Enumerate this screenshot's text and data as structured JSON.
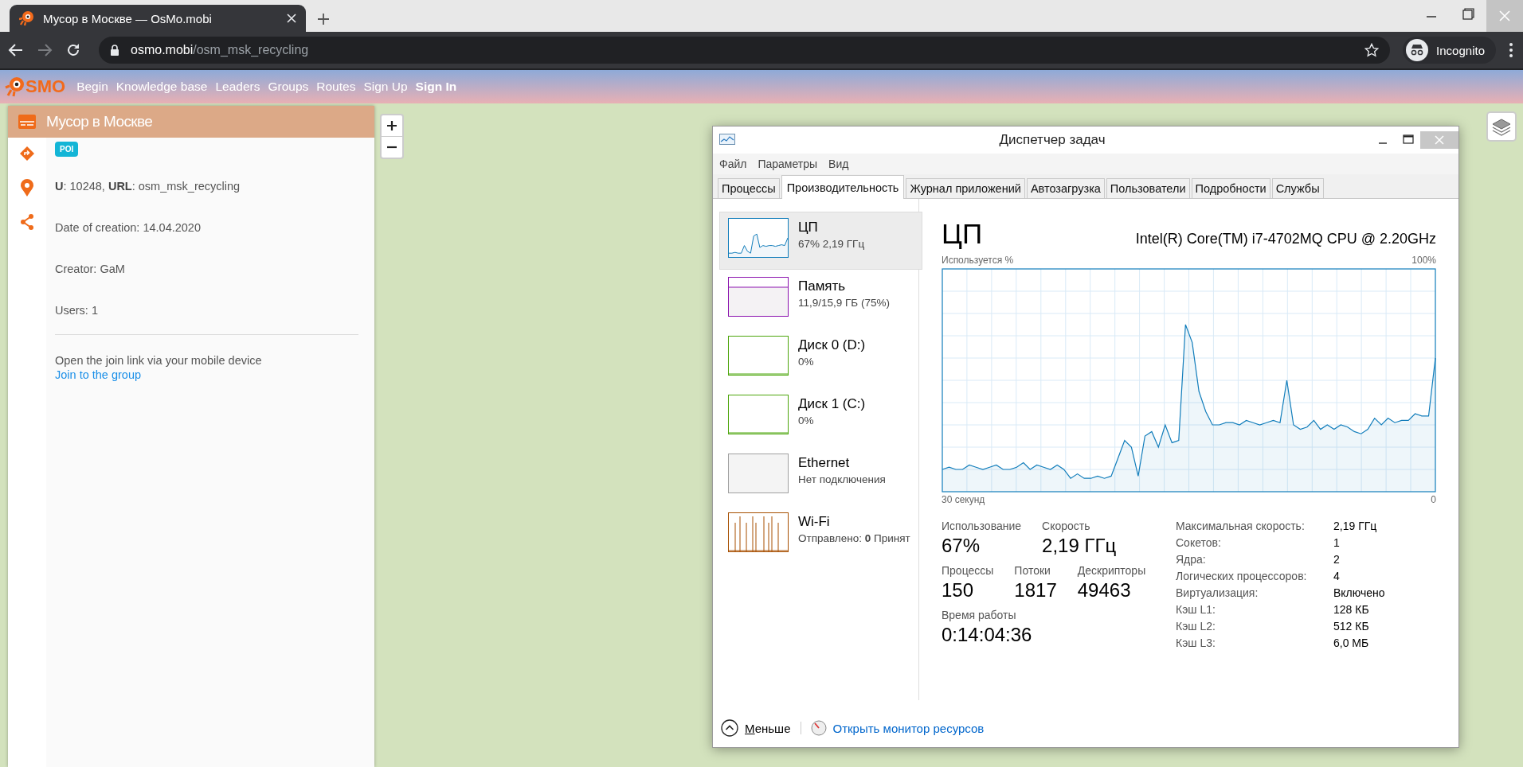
{
  "browser": {
    "tab_title": "Мусор в Москве — OsMo.mobi",
    "url_host": "osmo.mobi",
    "url_path": "/osm_msk_recycling",
    "profile": "Incognito"
  },
  "site": {
    "logo": "SMO",
    "nav": [
      {
        "label": "Begin",
        "kind": "link"
      },
      {
        "label": "Knowledge base",
        "kind": "link"
      },
      {
        "label": "Leaders",
        "kind": "link"
      },
      {
        "label": "Groups",
        "kind": "link"
      },
      {
        "label": "Routes",
        "kind": "link"
      },
      {
        "label": "Sign Up",
        "kind": "link"
      },
      {
        "label": "Sign In",
        "kind": "primary"
      }
    ]
  },
  "group_panel": {
    "title": "Мусор в Москве",
    "badge": "POI",
    "lines": [
      "**U**: 10248, **URL**: osm_msk_recycling",
      "Date of creation: 14.04.2020",
      "Creator: GaM",
      "Users: 1"
    ],
    "hint": "Open the join link via your mobile device",
    "link": "Join to the group"
  },
  "task_manager": {
    "title": "Диспетчер задач",
    "menu": [
      "Файл",
      "Параметры",
      "Вид"
    ],
    "tabs": [
      {
        "label": "Процессы",
        "selected": false
      },
      {
        "label": "Производительность",
        "selected": true
      },
      {
        "label": "Журнал приложений",
        "selected": false
      },
      {
        "label": "Автозагрузка",
        "selected": false
      },
      {
        "label": "Пользователи",
        "selected": false
      },
      {
        "label": "Подробности",
        "selected": false
      },
      {
        "label": "Службы",
        "selected": false
      }
    ],
    "resources": [
      {
        "kind": "cpu",
        "name": "ЦП",
        "detail": "67%  2,19 ГГц",
        "color": "#117dbb",
        "selected": true
      },
      {
        "kind": "memory",
        "name": "Память",
        "detail": "11,9/15,9 ГБ (75%)",
        "color": "#8b12ae",
        "selected": false
      },
      {
        "kind": "disk",
        "name": "Диск 0 (D:)",
        "detail": "0%",
        "color": "#4da60c",
        "selected": false
      },
      {
        "kind": "disk",
        "name": "Диск 1 (C:)",
        "detail": "0%",
        "color": "#4da60c",
        "selected": false
      },
      {
        "kind": "ethernet",
        "name": "Ethernet",
        "detail": "Нет подключения",
        "color": "#a0a0a0",
        "selected": false
      },
      {
        "kind": "wifi",
        "name": "Wi-Fi",
        "detail": "Отправлено: **0** Принят",
        "color": "#a74f01",
        "selected": false
      }
    ],
    "detail": {
      "heading": "ЦП",
      "model": "Intel(R) Core(TM) i7-4702MQ CPU @ 2.20GHz",
      "graph_label": "Используется %",
      "graph_max": "100%",
      "graph_time": "30 секунд",
      "graph_zero": "0",
      "stat_rows": [
        [
          {
            "label": "Использование",
            "value": "67%"
          },
          {
            "label": "Скорость",
            "value": "2,19 ГГц"
          }
        ],
        [
          {
            "label": "Процессы",
            "value": "150"
          },
          {
            "label": "Потоки",
            "value": "1817"
          },
          {
            "label": "Дескрипторы",
            "value": "49463"
          }
        ],
        [
          {
            "label": "Время работы",
            "value": "0:14:04:36"
          }
        ]
      ],
      "specs": [
        {
          "label": "Максимальная скорость:",
          "value": "2,19 ГГц"
        },
        {
          "label": "Сокетов:",
          "value": "1"
        },
        {
          "label": "Ядра:",
          "value": "2"
        },
        {
          "label": "Логических процессоров:",
          "value": "4"
        },
        {
          "label": "Виртуализация:",
          "value": "Включено"
        },
        {
          "label": "Кэш L1:",
          "value": "128 КБ"
        },
        {
          "label": "Кэш L2:",
          "value": "512 КБ"
        },
        {
          "label": "Кэш L3:",
          "value": "6,0 МБ"
        }
      ]
    },
    "footer": {
      "less": "Меньше",
      "monitor_link": "Открыть монитор ресурсов"
    }
  }
}
